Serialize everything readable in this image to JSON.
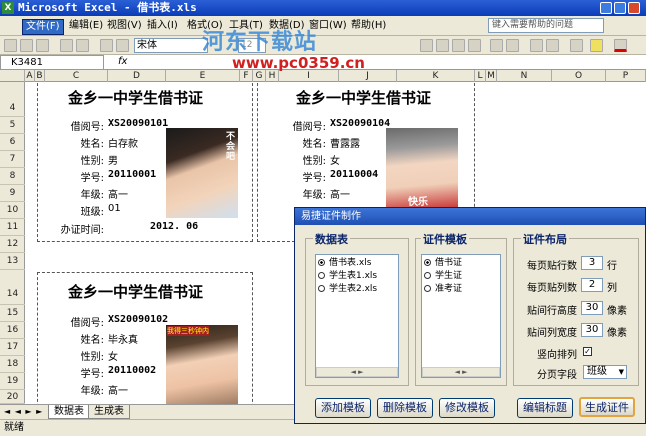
{
  "window": {
    "title": "Microsoft Excel - 借书表.xls",
    "app_badge": "X"
  },
  "menu": [
    "文件(F)",
    "编辑(E)",
    "视图(V)",
    "插入(I)",
    "格式(O)",
    "工具(T)",
    "数据(D)",
    "窗口(W)",
    "帮助(H)"
  ],
  "help_placeholder": "键入需要帮助的问题",
  "toolbar": {
    "font": "宋体",
    "size": "12"
  },
  "formula": {
    "namebox": "K3481",
    "fx": "fx"
  },
  "columns": [
    "A",
    "B",
    "C",
    "D",
    "E",
    "F",
    "G",
    "H",
    "I",
    "J",
    "K",
    "L",
    "M",
    "N",
    "O",
    "P"
  ],
  "rows": [
    "4",
    "5",
    "6",
    "7",
    "8",
    "9",
    "10",
    "11",
    "12",
    "13",
    "14",
    "15",
    "16",
    "17",
    "18",
    "19",
    "20"
  ],
  "cards": [
    {
      "title": "金乡一中学生借书证",
      "fields": [
        {
          "label": "借阅号:",
          "value": "XS20090101"
        },
        {
          "label": "姓名:",
          "value": "白存款"
        },
        {
          "label": "性别:",
          "value": "男"
        },
        {
          "label": "学号:",
          "value": "20110001"
        },
        {
          "label": "年级:",
          "value": "高一"
        },
        {
          "label": "班级:",
          "value": "01"
        }
      ],
      "date_label": "办证时间:",
      "date": "2012. 06",
      "photo_caption": "不会吧"
    },
    {
      "title": "金乡一中学生借书证",
      "fields": [
        {
          "label": "借阅号:",
          "value": "XS20090104"
        },
        {
          "label": "姓名:",
          "value": "曹露露"
        },
        {
          "label": "性别:",
          "value": "女"
        },
        {
          "label": "学号:",
          "value": "20110004"
        },
        {
          "label": "年级:",
          "value": "高一"
        }
      ],
      "photo_caption": "快乐"
    },
    {
      "title": "金乡一中学生借书证",
      "fields": [
        {
          "label": "借阅号:",
          "value": "XS20090102"
        },
        {
          "label": "姓名:",
          "value": "毕永真"
        },
        {
          "label": "性别:",
          "value": "女"
        },
        {
          "label": "学号:",
          "value": "20110002"
        },
        {
          "label": "年级:",
          "value": "高一"
        }
      ],
      "photo_caption": "我得三秒钟内"
    }
  ],
  "sheets": [
    "数据表",
    "生成表"
  ],
  "status": "就绪",
  "dialog": {
    "title": "易捷证件制作",
    "groups": {
      "data": "数据表",
      "template": "证件模板",
      "layout": "证件布局"
    },
    "data_items": [
      "借书表.xls",
      "学生表1.xls",
      "学生表2.xls"
    ],
    "template_items": [
      "借书证",
      "学生证",
      "准考证"
    ],
    "layout": {
      "rows_label": "每页贴行数",
      "rows_value": "3",
      "rows_unit": "行",
      "cols_label": "每页贴列数",
      "cols_value": "2",
      "cols_unit": "列",
      "rowgap_label": "贴间行高度",
      "rowgap_value": "30",
      "rowgap_unit": "像素",
      "colgap_label": "贴间列宽度",
      "colgap_value": "30",
      "colgap_unit": "像素",
      "vertical_label": "竖向排列",
      "vertical_check": "✓",
      "page_field_label": "分页字段",
      "page_field_value": "班级"
    },
    "buttons": [
      "添加模板",
      "删除模板",
      "修改模板",
      "编辑标题",
      "生成证件"
    ]
  },
  "watermark": {
    "text": "河东下载站",
    "url": "www.pc0359.cn"
  }
}
